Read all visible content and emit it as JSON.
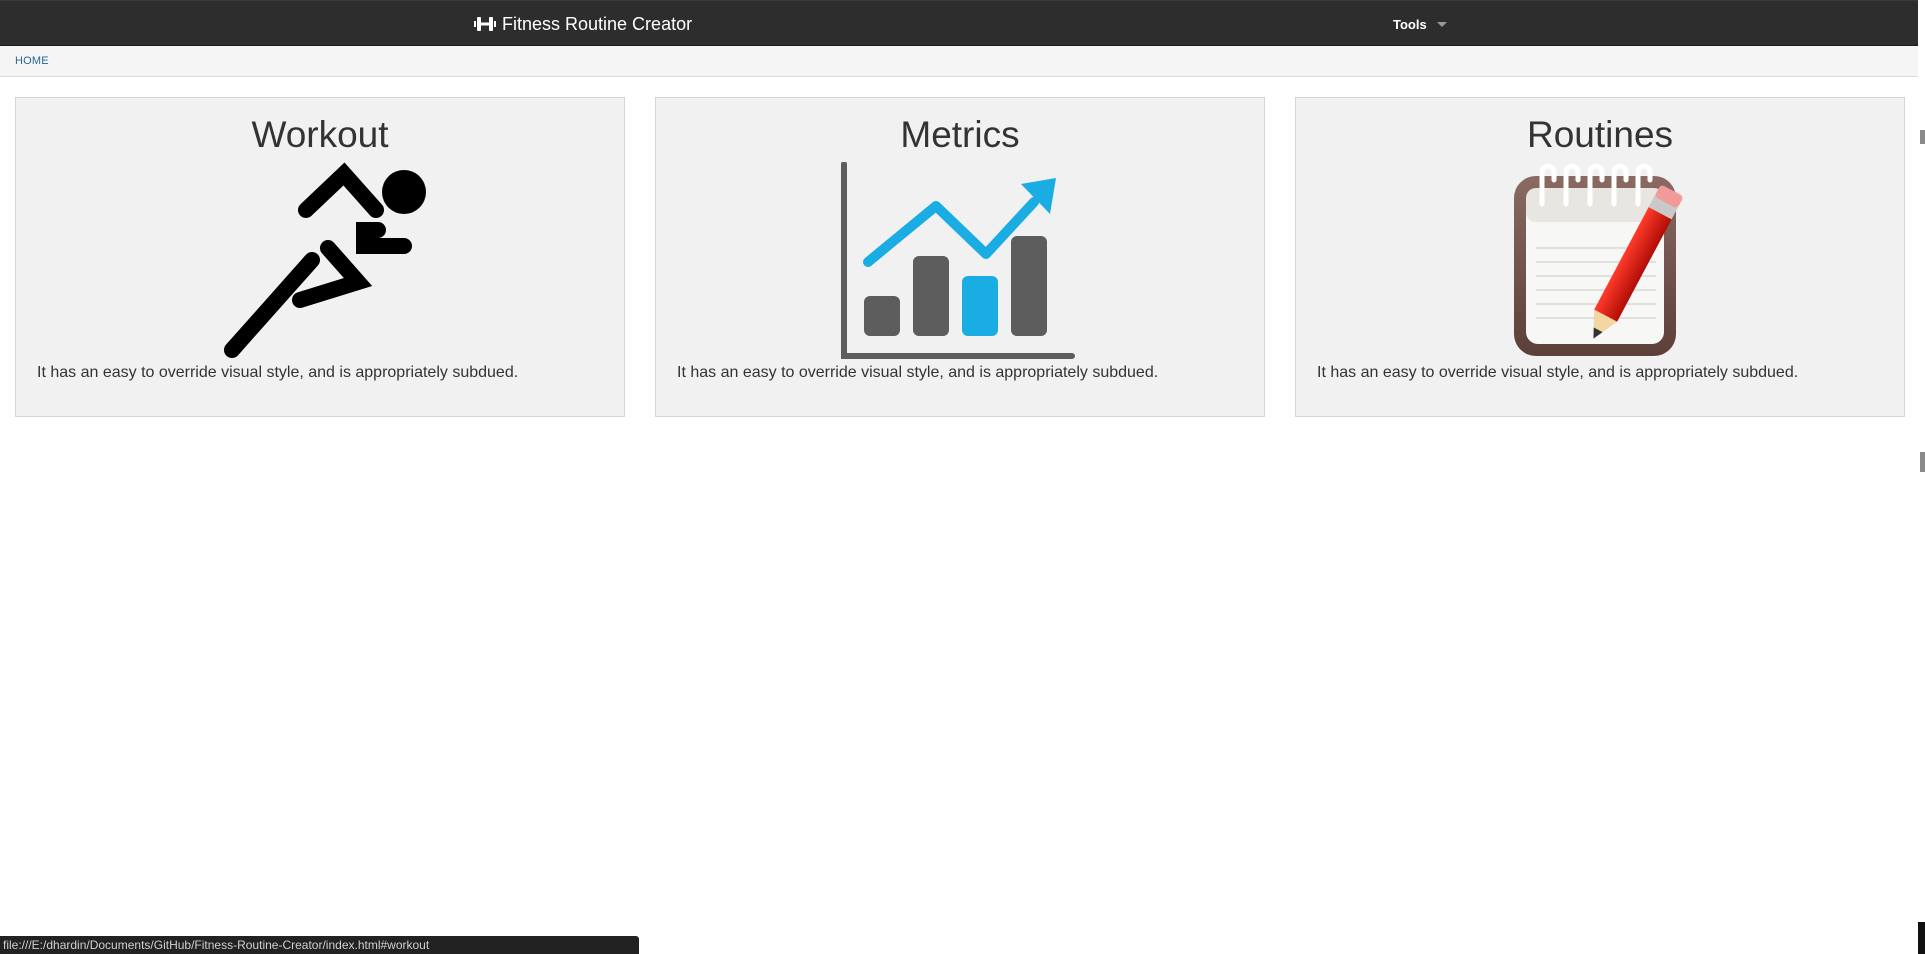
{
  "app": {
    "title": "Fitness Routine Creator",
    "brand_icon": "dumbbell-icon"
  },
  "nav": {
    "tools_label": "Tools"
  },
  "breadcrumb": {
    "home": "HOME"
  },
  "cards": [
    {
      "title": "Workout",
      "icon": "runner-icon",
      "text": "It has an easy to override visual style, and is appropriately subdued."
    },
    {
      "title": "Metrics",
      "icon": "growth-chart-icon",
      "text": "It has an easy to override visual style, and is appropriately subdued."
    },
    {
      "title": "Routines",
      "icon": "notepad-pencil-icon",
      "text": "It has an easy to override visual style, and is appropriately subdued."
    }
  ],
  "status": {
    "url": "file:///E:/dhardin/Documents/GitHub/Fitness-Routine-Creator/index.html#workout"
  },
  "colors": {
    "navbar": "#2d2d2d",
    "accent": "#1aade3",
    "card_bg": "#f1f1f1",
    "link": "#2a6496"
  }
}
